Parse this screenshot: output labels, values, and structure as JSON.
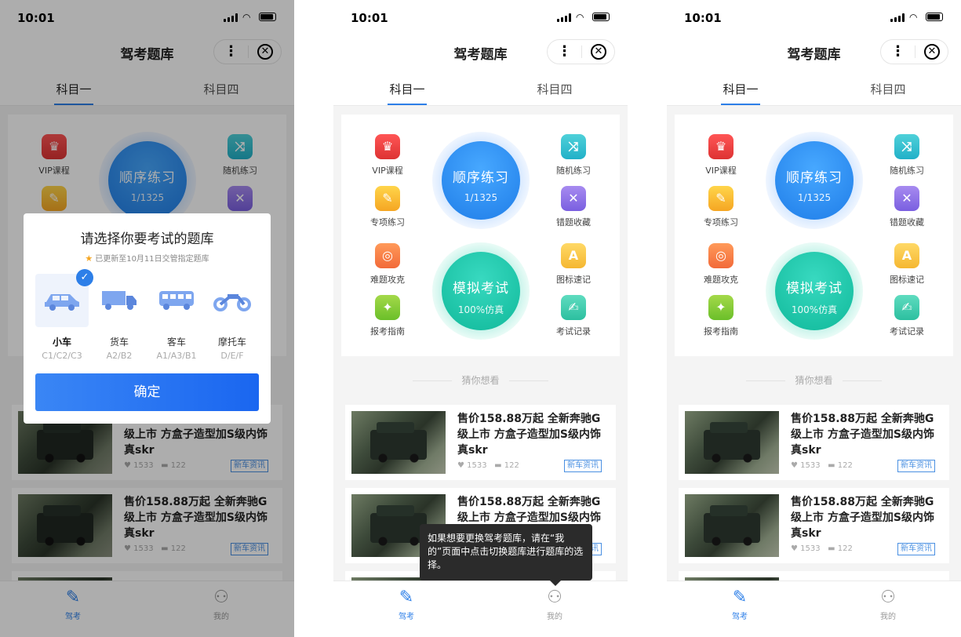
{
  "status": {
    "time": "10:01"
  },
  "nav": {
    "title": "驾考题库",
    "more": "⋮",
    "close": "✕"
  },
  "tabs": [
    "科目一",
    "科目四"
  ],
  "functions": {
    "vip": "VIP课程",
    "special": "专项练习",
    "random": "随机练习",
    "wrong": "错题收藏",
    "hard": "难题攻克",
    "guide": "报考指南",
    "signs": "图标速记",
    "record": "考试记录"
  },
  "circles": {
    "order": {
      "title": "顺序练习",
      "progress": "1/1325"
    },
    "exam": {
      "title": "模拟考试",
      "sub": "100%仿真"
    }
  },
  "guess_title": "猜你想看",
  "news": [
    {
      "title": "售价158.88万起 全新奔驰G级上市 方盒子造型加S级内饰真skr",
      "likes": "1533",
      "comments": "122",
      "tag": "新车资讯"
    },
    {
      "title": "售价158.88万起 全新奔驰G级上市 方盒子造型加S级内饰真skr",
      "likes": "1533",
      "comments": "122",
      "tag": "新车资讯"
    }
  ],
  "tabbar": {
    "drive": "驾考",
    "mine": "我的"
  },
  "dialog": {
    "title": "请选择你要考试的题库",
    "subtitle": "已更新至10月11日交管指定题库",
    "vehicles": [
      {
        "name": "小车",
        "code": "C1/C2/C3",
        "icon": "car-icon",
        "selected": true
      },
      {
        "name": "货车",
        "code": "A2/B2",
        "icon": "truck-icon",
        "selected": false
      },
      {
        "name": "客车",
        "code": "A1/A3/B1",
        "icon": "bus-icon",
        "selected": false
      },
      {
        "name": "摩托车",
        "code": "D/E/F",
        "icon": "motorcycle-icon",
        "selected": false
      }
    ],
    "confirm": "确定"
  },
  "tooltip": "如果想要更换驾考题库，请在“我的”页面中点击切换题库进行题库的选择。",
  "colors": {
    "primary": "#2d7fe8",
    "mask": "rgba(0,0,0,0.32)"
  }
}
